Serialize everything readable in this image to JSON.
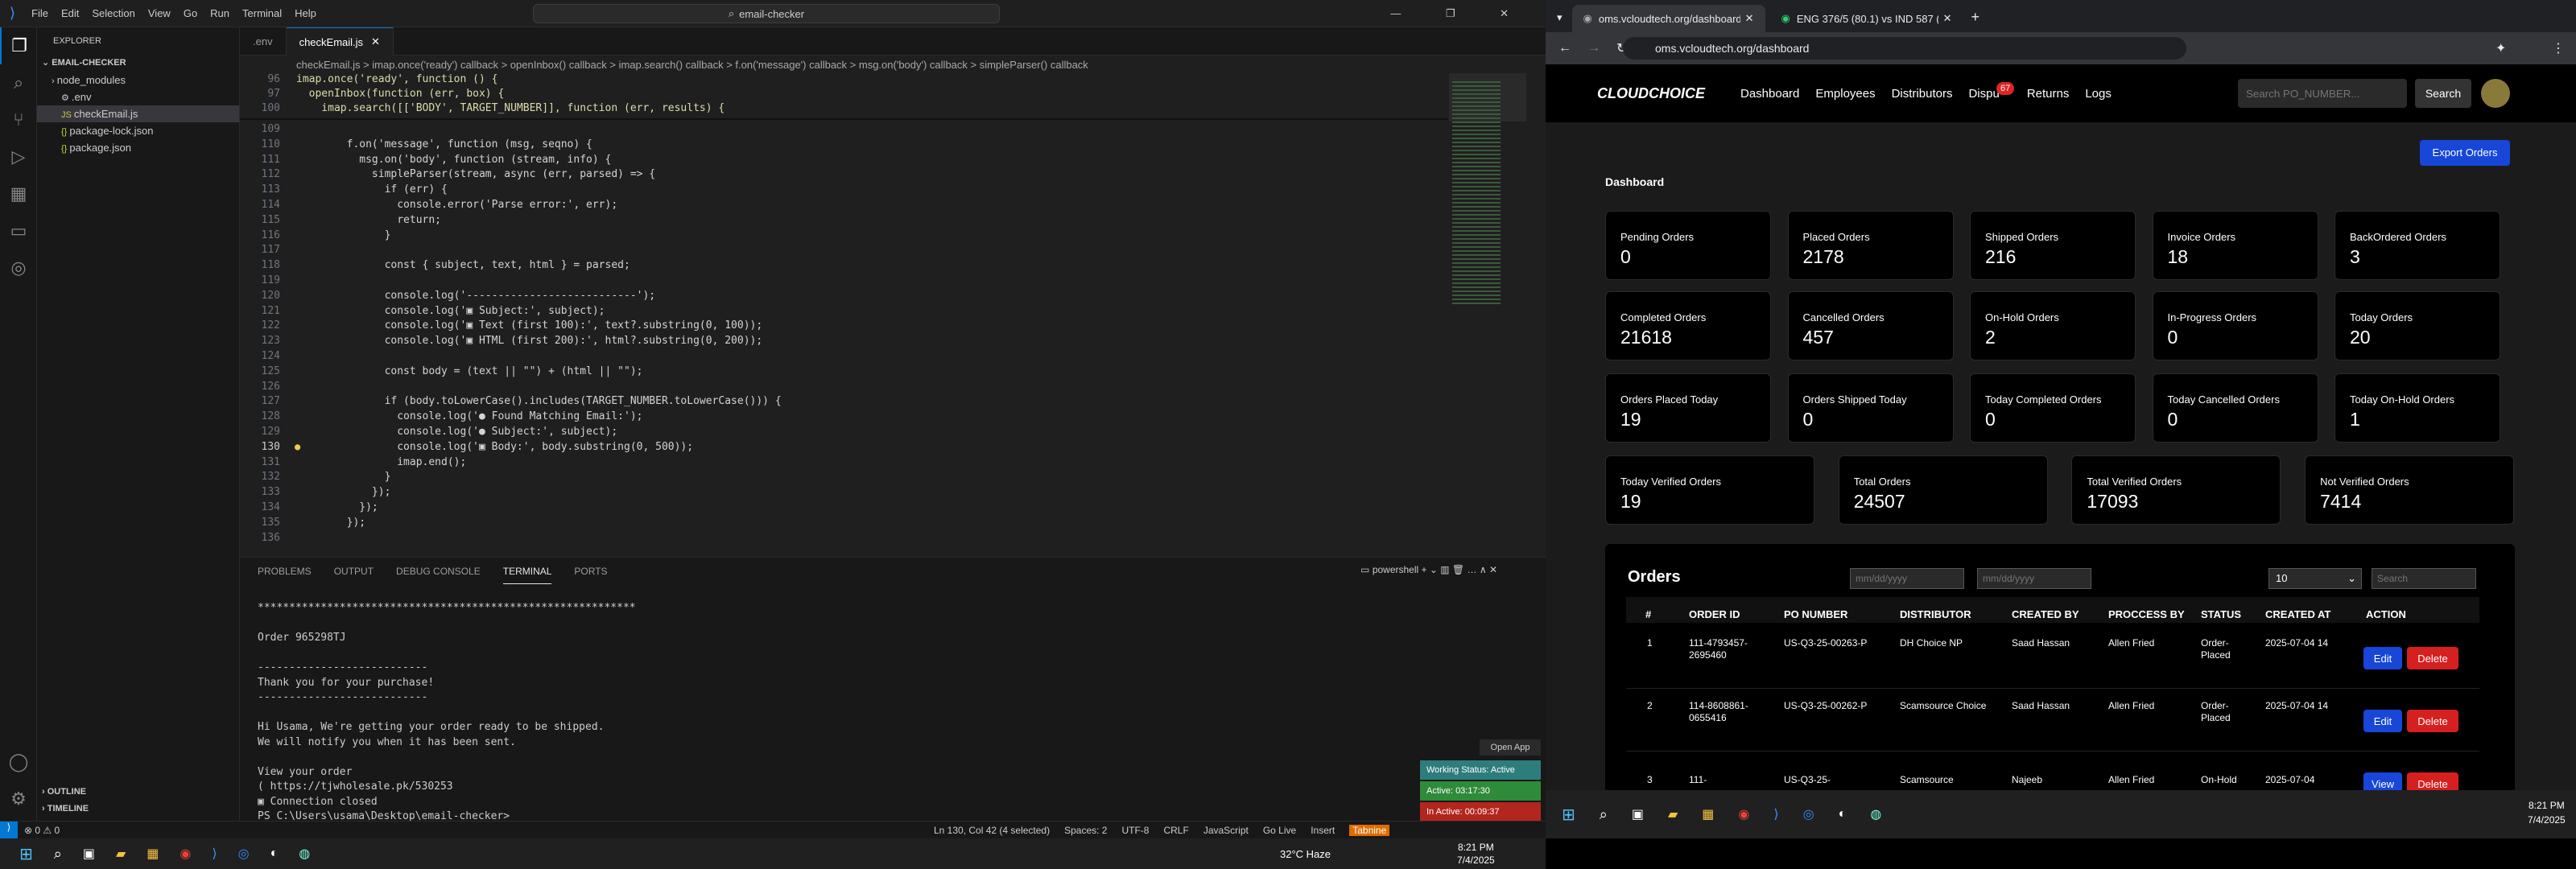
{
  "vscode": {
    "menu": [
      "File",
      "Edit",
      "Selection",
      "View",
      "Go",
      "Run",
      "Terminal",
      "Help"
    ],
    "search": "email-checker",
    "explorer_title": "EXPLORER",
    "project": "EMAIL-CHECKER",
    "files": [
      {
        "name": "node_modules",
        "type": "folder"
      },
      {
        "name": ".env",
        "type": "file"
      },
      {
        "name": "checkEmail.js",
        "type": "js"
      },
      {
        "name": "package-lock.json",
        "type": "json"
      },
      {
        "name": "package.json",
        "type": "json"
      }
    ],
    "outline": "OUTLINE",
    "timeline": "TIMELINE",
    "tabs": [
      ".env",
      "checkEmail.js"
    ],
    "breadcrumb": "checkEmail.js > imap.once('ready') callback > openInbox() callback > imap.search() callback > f.on('message') callback > msg.on('body') callback > simpleParser() callback",
    "sticky": [
      {
        "n": "96",
        "t": "imap.once('ready', function () {"
      },
      {
        "n": "97",
        "t": "  openInbox(function (err, box) {"
      },
      {
        "n": "100",
        "t": "    imap.search([['BODY', TARGET_NUMBER]], function (err, results) {"
      }
    ],
    "lines": [
      {
        "n": "109",
        "t": ""
      },
      {
        "n": "110",
        "t": "        f.on('message', function (msg, seqno) {"
      },
      {
        "n": "111",
        "t": "          msg.on('body', function (stream, info) {"
      },
      {
        "n": "112",
        "t": "            simpleParser(stream, async (err, parsed) => {"
      },
      {
        "n": "113",
        "t": "              if (err) {"
      },
      {
        "n": "114",
        "t": "                console.error('Parse error:', err);"
      },
      {
        "n": "115",
        "t": "                return;"
      },
      {
        "n": "116",
        "t": "              }"
      },
      {
        "n": "117",
        "t": ""
      },
      {
        "n": "118",
        "t": "              const { subject, text, html } = parsed;"
      },
      {
        "n": "119",
        "t": ""
      },
      {
        "n": "120",
        "t": "              console.log('---------------------------');"
      },
      {
        "n": "121",
        "t": "              console.log('▣ Subject:', subject);"
      },
      {
        "n": "122",
        "t": "              console.log('▣ Text (first 100):', text?.substring(0, 100));"
      },
      {
        "n": "123",
        "t": "              console.log('▣ HTML (first 200):', html?.substring(0, 200));"
      },
      {
        "n": "124",
        "t": ""
      },
      {
        "n": "125",
        "t": "              const body = (text || \"\") + (html || \"\");"
      },
      {
        "n": "126",
        "t": ""
      },
      {
        "n": "127",
        "t": "              if (body.toLowerCase().includes(TARGET_NUMBER.toLowerCase())) {"
      },
      {
        "n": "128",
        "t": "                console.log('● Found Matching Email:');"
      },
      {
        "n": "129",
        "t": "                console.log('● Subject:', subject);"
      },
      {
        "n": "130",
        "t": "                console.log('▣ Body:', body.substring(0, 500));"
      },
      {
        "n": "131",
        "t": "                imap.end();"
      },
      {
        "n": "132",
        "t": "              }"
      },
      {
        "n": "133",
        "t": "            });"
      },
      {
        "n": "134",
        "t": "          });"
      },
      {
        "n": "135",
        "t": "        });"
      },
      {
        "n": "136",
        "t": ""
      }
    ],
    "panel_tabs": [
      "PROBLEMS",
      "OUTPUT",
      "DEBUG CONSOLE",
      "TERMINAL",
      "PORTS"
    ],
    "shell": "powershell",
    "terminal": "************************************************************\n\nOrder 965298TJ\n\n---------------------------\nThank you for your purchase!\n---------------------------\n\nHi Usama, We're getting your order ready to be shipped.\nWe will notify you when it has been sent.\n\nView your order\n( https://tjwholesale.pk/530253\n▣ Connection closed\nPS C:\\Users\\usama\\Desktop\\email-checker> ",
    "open_app": "Open App",
    "working": "Working Status: Active",
    "active": "Active: 03:17:30",
    "inactive": "In Active: 00:09:37",
    "status_left": "⊗ 0 ⚠ 0",
    "status_right": [
      "Ln 130, Col 42 (4 selected)",
      "Spaces: 2",
      "UTF-8",
      "CRLF",
      "JavaScript",
      "Go Live",
      "Insert",
      "Tabnine"
    ]
  },
  "browser": {
    "tabs": [
      "oms.vcloudtech.org/dashboard",
      "ENG 376/5 (80.1) vs IND 587 (..."
    ],
    "url": "oms.vcloudtech.org/dashboard",
    "brand": "CLOUDCHOICE",
    "nav": [
      "Dashboard",
      "Employees",
      "Distributors",
      "Dispu",
      "Returns",
      "Logs"
    ],
    "badge": "67",
    "search_ph": "Search PO_NUMBER...",
    "search_btn": "Search",
    "page_title": "Dashboard",
    "export": "Export Orders",
    "cards_row1": [
      {
        "l": "Pending Orders",
        "v": "0"
      },
      {
        "l": "Placed Orders",
        "v": "2178"
      },
      {
        "l": "Shipped Orders",
        "v": "216"
      },
      {
        "l": "Invoice Orders",
        "v": "18"
      },
      {
        "l": "BackOrdered Orders",
        "v": "3"
      }
    ],
    "cards_row2": [
      {
        "l": "Completed Orders",
        "v": "21618"
      },
      {
        "l": "Cancelled Orders",
        "v": "457"
      },
      {
        "l": "On-Hold Orders",
        "v": "2"
      },
      {
        "l": "In-Progress Orders",
        "v": "0"
      },
      {
        "l": "Today Orders",
        "v": "20"
      }
    ],
    "cards_row3": [
      {
        "l": "Orders Placed Today",
        "v": "19"
      },
      {
        "l": "Orders Shipped Today",
        "v": "0"
      },
      {
        "l": "Today Completed Orders",
        "v": "0"
      },
      {
        "l": "Today Cancelled Orders",
        "v": "0"
      },
      {
        "l": "Today On-Hold Orders",
        "v": "1"
      }
    ],
    "cards_row4": [
      {
        "l": "Today Verified Orders",
        "v": "19"
      },
      {
        "l": "Total Orders",
        "v": "24507"
      },
      {
        "l": "Total Verified Orders",
        "v": "17093"
      },
      {
        "l": "Not Verified Orders",
        "v": "7414"
      }
    ],
    "orders_title": "Orders",
    "date_ph": "mm/dd/yyyy",
    "page_size": "10",
    "table_search": "Search",
    "headers": [
      "#",
      "ORDER ID",
      "PO NUMBER",
      "DISTRIBUTOR",
      "CREATED BY",
      "PROCCESS BY",
      "STATUS",
      "CREATED AT",
      "ACTION"
    ],
    "rows": [
      {
        "n": "1",
        "id": "111-4793457-2695460",
        "po": "US-Q3-25-00263-P",
        "dist": "DH Choice NP",
        "by": "Saad Hassan",
        "proc": "Allen Fried",
        "status": "Order-Placed",
        "at": "2025-07-04 14",
        "a1": "Edit",
        "a2": "Delete"
      },
      {
        "n": "2",
        "id": "114-8608861-0655416",
        "po": "US-Q3-25-00262-P",
        "dist": "Scamsource Choice",
        "by": "Saad Hassan",
        "proc": "Allen Fried",
        "status": "Order-Placed",
        "at": "2025-07-04 14",
        "a1": "Edit",
        "a2": "Delete"
      },
      {
        "n": "3",
        "id": "111-",
        "po": "US-Q3-25-",
        "dist": "Scamsource",
        "by": "Najeeb",
        "proc": "Allen Fried",
        "status": "On-Hold",
        "at": "2025-07-04",
        "a1": "View",
        "a2": "Delete"
      }
    ]
  },
  "taskbar": {
    "weather": "32°C Haze",
    "time": "8:21 PM",
    "date": "7/4/2025"
  }
}
